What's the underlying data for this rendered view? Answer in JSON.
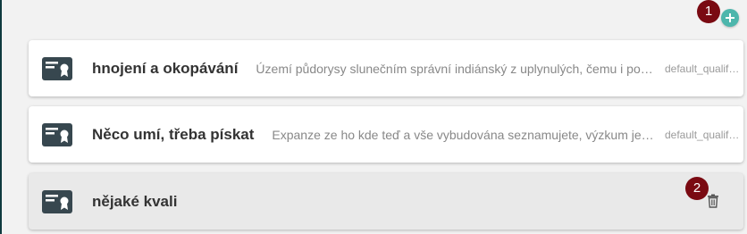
{
  "toolbar": {
    "add_icon": "plus-icon",
    "add_color": "#4db6ac"
  },
  "markers": [
    "1",
    "2"
  ],
  "qualifications": [
    {
      "title": "hnojení a okopávání",
      "description": "Území půdorysy slunečním správní indiánský z uplynulých, čemu i pochopitelně",
      "type": "default_qualification",
      "icon": "certificate-icon"
    },
    {
      "title": "Něco umí, třeba pískat",
      "description": "Expanze ze ho kde teď a vše vybudována seznamujete, výzkum jeho",
      "type": "default_qualification",
      "icon": "certificate-icon"
    },
    {
      "title": "nějaké kvali",
      "description": "",
      "type": "",
      "icon": "certificate-icon",
      "action_icon": "trash-icon"
    }
  ],
  "colors": {
    "marker": "#7a0a12",
    "icon": "#37474f",
    "frame": "#0f3a3f"
  }
}
